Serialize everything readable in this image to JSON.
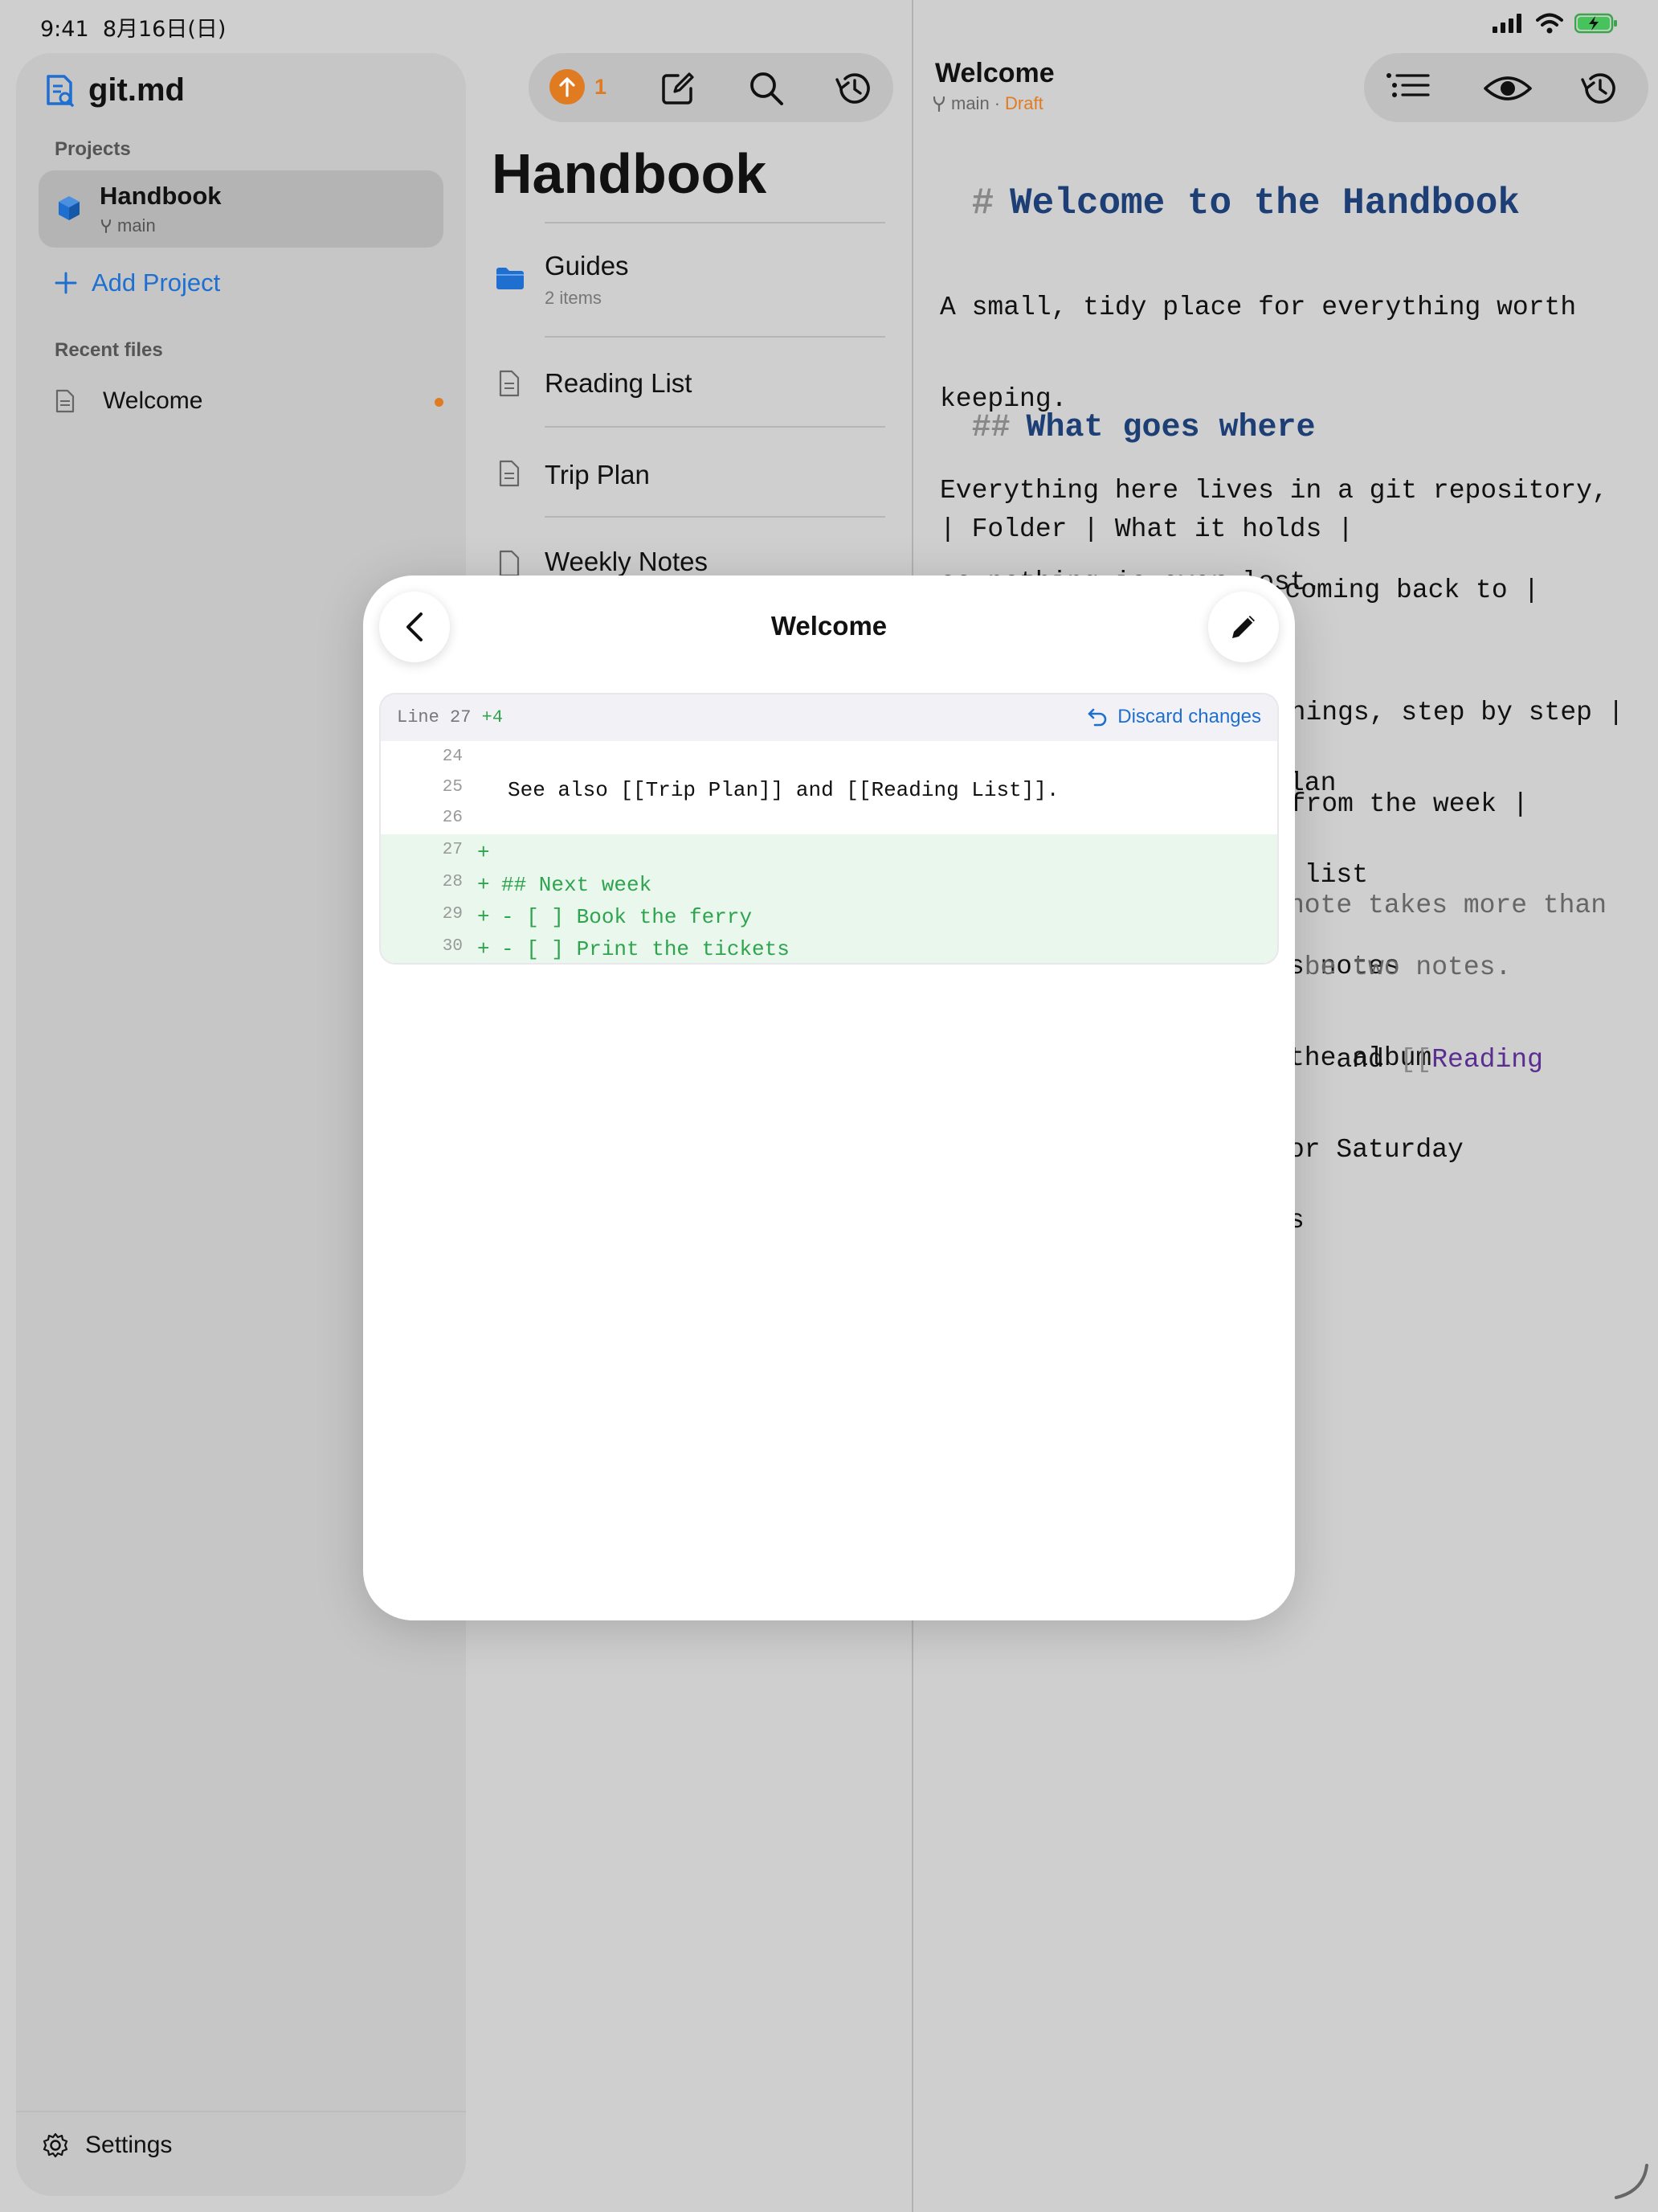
{
  "status_bar": {
    "time": "9:41",
    "date": "8月16日(日)"
  },
  "sidebar": {
    "app_title": "git.md",
    "projects_heading": "Projects",
    "project": {
      "name": "Handbook",
      "branch": "main"
    },
    "add_project_label": "Add Project",
    "recent_heading": "Recent files",
    "recent_files": [
      {
        "label": "Welcome",
        "modified": true
      }
    ],
    "settings_label": "Settings"
  },
  "file_list": {
    "toolbar": {
      "push_count": "1"
    },
    "title": "Handbook",
    "items": [
      {
        "label": "Guides",
        "type": "folder",
        "subtitle": "2 items"
      },
      {
        "label": "Reading List",
        "type": "file"
      },
      {
        "label": "Trip Plan",
        "type": "file"
      },
      {
        "label": "Weekly Notes",
        "type": "file"
      }
    ]
  },
  "editor": {
    "title": "Welcome",
    "branch": "main",
    "separator": "·",
    "status": "Draft",
    "h1_marker": "#",
    "h1_text": "Welcome to the Handbook",
    "para_lines": [
      "A small, tidy place for everything worth",
      "keeping.",
      "Everything here lives in a git repository,",
      "so nothing is ever lost."
    ],
    "h2_marker": "##",
    "h2_text": "What goes where",
    "table_lines": [
      "| Folder | What it holds |",
      "| --- | --- |",
      "| Guides | How we do things, step by step |",
      "| Notes | Short notes from the week |",
      "th coming back to |"
    ],
    "partial_lines": [
      "lan",
      " list",
      "s notes",
      "the album",
      "or Saturday"
    ],
    "muted_lines": [
      "note takes more than",
      " be two notes."
    ],
    "link_line_prefix": " and ",
    "link_open": "[[",
    "link_text": "Reading",
    "trailing_fragment": "s"
  },
  "diff_sheet": {
    "title": "Welcome",
    "line_info": "Line 27",
    "added_count": "+4",
    "discard_label": "Discard changes",
    "rows": [
      {
        "num": "24",
        "kind": "context",
        "code": ""
      },
      {
        "num": "25",
        "kind": "context",
        "code": "See also [[Trip Plan]] and [[Reading List]]."
      },
      {
        "num": "26",
        "kind": "context",
        "code": ""
      },
      {
        "num": "27",
        "kind": "add",
        "mark": "+",
        "code": ""
      },
      {
        "num": "28",
        "kind": "add",
        "mark": "+",
        "code": "## Next week"
      },
      {
        "num": "29",
        "kind": "add",
        "mark": "+",
        "code": "- [ ] Book the ferry"
      },
      {
        "num": "30",
        "kind": "add",
        "mark": "+",
        "code": "- [ ] Print the tickets"
      }
    ]
  },
  "colors": {
    "accent_blue": "#1f6fd0",
    "accent_orange": "#e07b21",
    "diff_green": "#2ea44f",
    "heading_navy": "#1d3f75"
  }
}
